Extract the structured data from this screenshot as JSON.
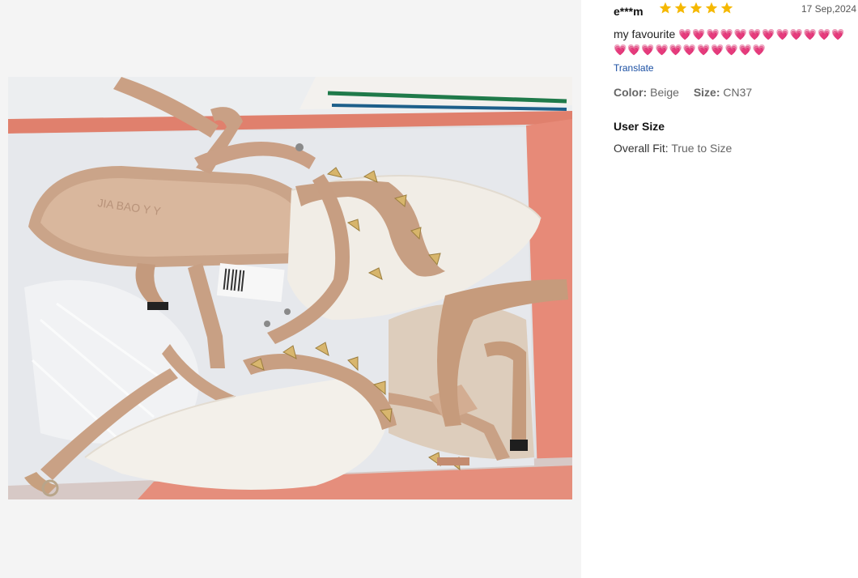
{
  "review": {
    "reviewer": "e***m",
    "rating": 5,
    "date": "17 Sep,2024",
    "text": "my favourite",
    "hearts": "💗💗💗💗💗💗💗💗💗💗💗💗💗💗💗💗💗💗💗💗💗💗💗",
    "translate_label": "Translate",
    "color_label": "Color:",
    "color_value": "Beige",
    "size_label": "Size:",
    "size_value": "CN37",
    "user_size_title": "User Size",
    "fit_label": "Overall Fit:",
    "fit_value": "True to Size",
    "star_color": "#f5b800"
  },
  "photo": {
    "brand_imprint": "JIABAOYY",
    "alt": "Beige pointed-toe studded slingback heels in a shoe box"
  }
}
